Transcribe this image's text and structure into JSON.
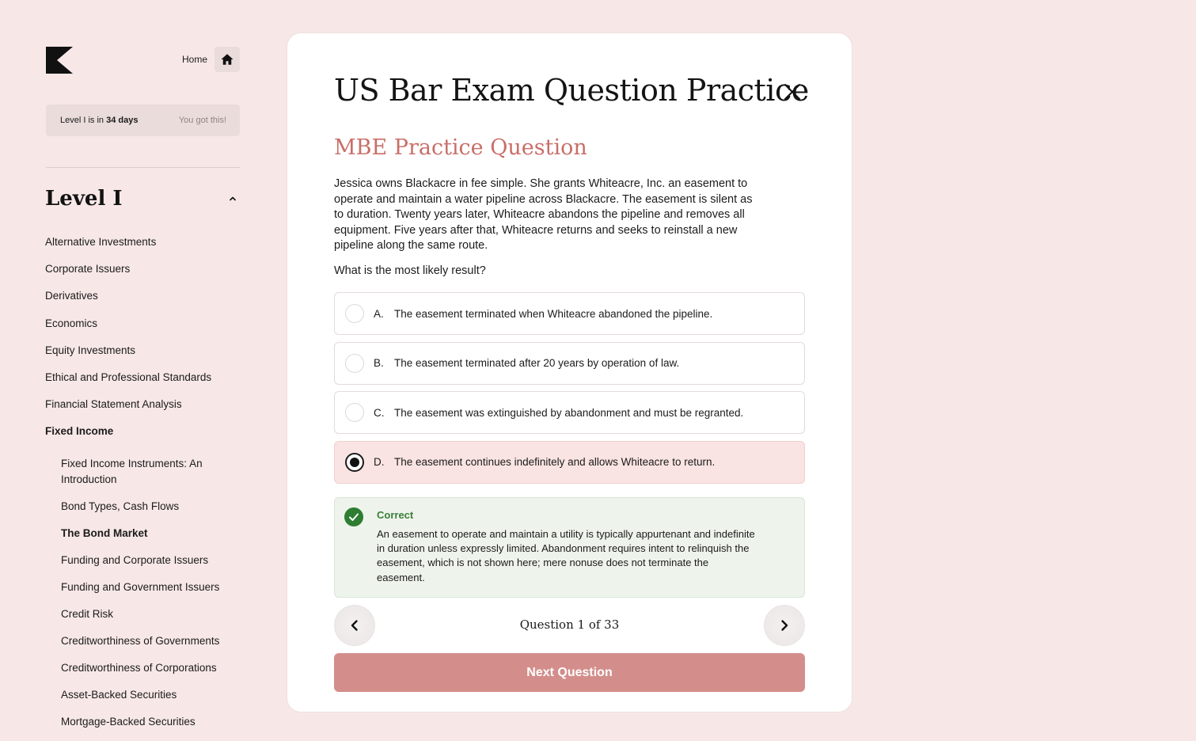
{
  "brand": {
    "logo_icon": "k-logo-icon"
  },
  "home": {
    "label": "Home",
    "icon": "home-icon"
  },
  "countdown": {
    "prefix": "Level I is in",
    "days": "34 days",
    "encouragement": "You got this!"
  },
  "sidebar": {
    "level_title": "Level I",
    "collapse_icon": "chevron-up-icon",
    "items": [
      {
        "label": "Alternative Investments",
        "active": false
      },
      {
        "label": "Corporate Issuers",
        "active": false
      },
      {
        "label": "Derivatives",
        "active": false
      },
      {
        "label": "Economics",
        "active": false
      },
      {
        "label": "Equity Investments",
        "active": false
      },
      {
        "label": "Ethical and Professional Standards",
        "active": false
      },
      {
        "label": "Financial Statement Analysis",
        "active": false
      },
      {
        "label": "Fixed Income",
        "active": true
      }
    ],
    "sub_items": [
      {
        "label": "Fixed Income Instruments: An Introduction",
        "active": false
      },
      {
        "label": "Bond Types, Cash Flows",
        "active": false
      },
      {
        "label": "The Bond Market",
        "active": true
      },
      {
        "label": "Funding and Corporate Issuers",
        "active": false
      },
      {
        "label": "Funding and Government Issuers",
        "active": false
      },
      {
        "label": "Credit Risk",
        "active": false
      },
      {
        "label": "Creditworthiness of Governments",
        "active": false
      },
      {
        "label": "Creditworthiness of Corporations",
        "active": false
      },
      {
        "label": "Asset-Backed Securities",
        "active": false
      },
      {
        "label": "Mortgage-Backed Securities",
        "active": false
      }
    ]
  },
  "card": {
    "title": "US Bar Exam Question Practice",
    "close_icon": "close-icon",
    "subtitle": "MBE Practice Question",
    "question": "Jessica owns Blackacre in fee simple. She grants Whiteacre, Inc. an easement to operate and maintain a water pipeline across Blackacre. The easement is silent as to duration. Twenty years later, Whiteacre abandons the pipeline and removes all equipment. Five years after that, Whiteacre returns and seeks to reinstall a new pipeline along the same route.",
    "prompt": "What is the most likely result?",
    "options": [
      {
        "letter": "A.",
        "text": "The easement terminated when Whiteacre abandoned the pipeline.",
        "selected": false
      },
      {
        "letter": "B.",
        "text": "The easement terminated after 20 years by operation of law.",
        "selected": false
      },
      {
        "letter": "C.",
        "text": "The easement was extinguished by abandonment and must be regranted.",
        "selected": false
      },
      {
        "letter": "D.",
        "text": "The easement continues indefinitely and allows Whiteacre to return.",
        "selected": true
      }
    ],
    "feedback": {
      "icon": "check-circle-icon",
      "title": "Correct",
      "text": "An easement to operate and maintain a utility is typically appurtenant and indefinite in duration unless expressly limited. Abandonment requires intent to relinquish the easement, which is not shown here; mere nonuse does not terminate the easement."
    },
    "pager": {
      "label": "Question 1 of 33",
      "prev_icon": "chevron-left-icon",
      "next_icon": "chevron-right-icon"
    },
    "next_button": "Next Question"
  },
  "colors": {
    "background": "#f7e8e7",
    "accent": "#c96e68",
    "button": "#d38e8b",
    "selected_option": "#fae4e3",
    "correct_bg": "#eef4ec",
    "correct_text": "#3a7d3a",
    "correct_icon": "#2e7d32"
  }
}
